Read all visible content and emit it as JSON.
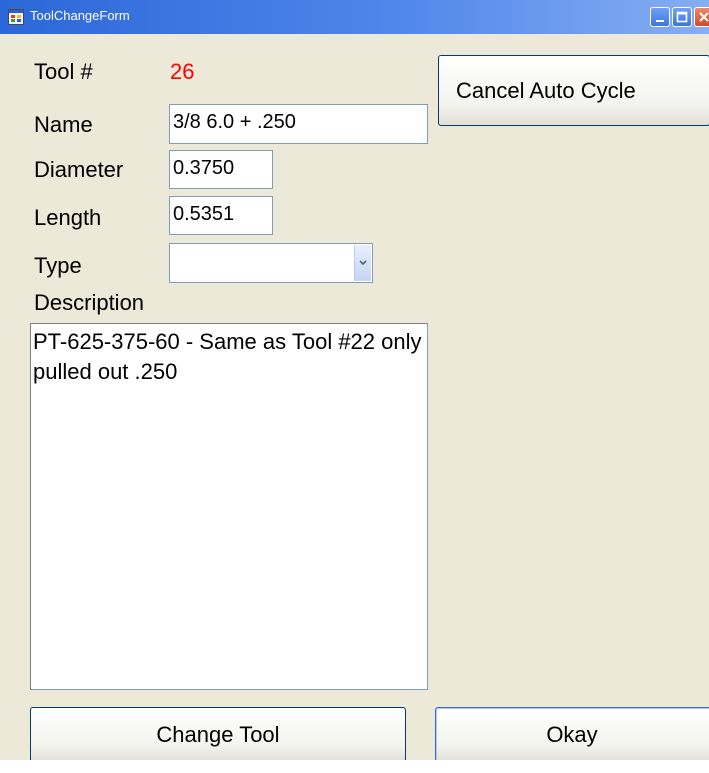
{
  "window": {
    "title": "ToolChangeForm",
    "icon": "app-window-icon",
    "caption_buttons": [
      "minimize-icon",
      "maximize-icon",
      "close-icon"
    ],
    "background_color": "#ece9d8",
    "titlebar_color": "#2b67d8"
  },
  "form": {
    "tool_label": "Tool #",
    "tool_number": "26",
    "tool_number_color": "#ff0000",
    "name_label": "Name",
    "name_value": "3/8 6.0 + .250",
    "diameter_label": "Diameter",
    "diameter_value": "0.3750",
    "length_label": "Length",
    "length_value": "0.5351",
    "type_label": "Type",
    "type_value": "",
    "description_label": "Description",
    "description_value": "PT-625-375-60 - Same as Tool #22 only pulled out .250"
  },
  "buttons": {
    "cancel_auto_cycle": "Cancel Auto Cycle",
    "change_tool": "Change Tool",
    "okay": "Okay"
  }
}
